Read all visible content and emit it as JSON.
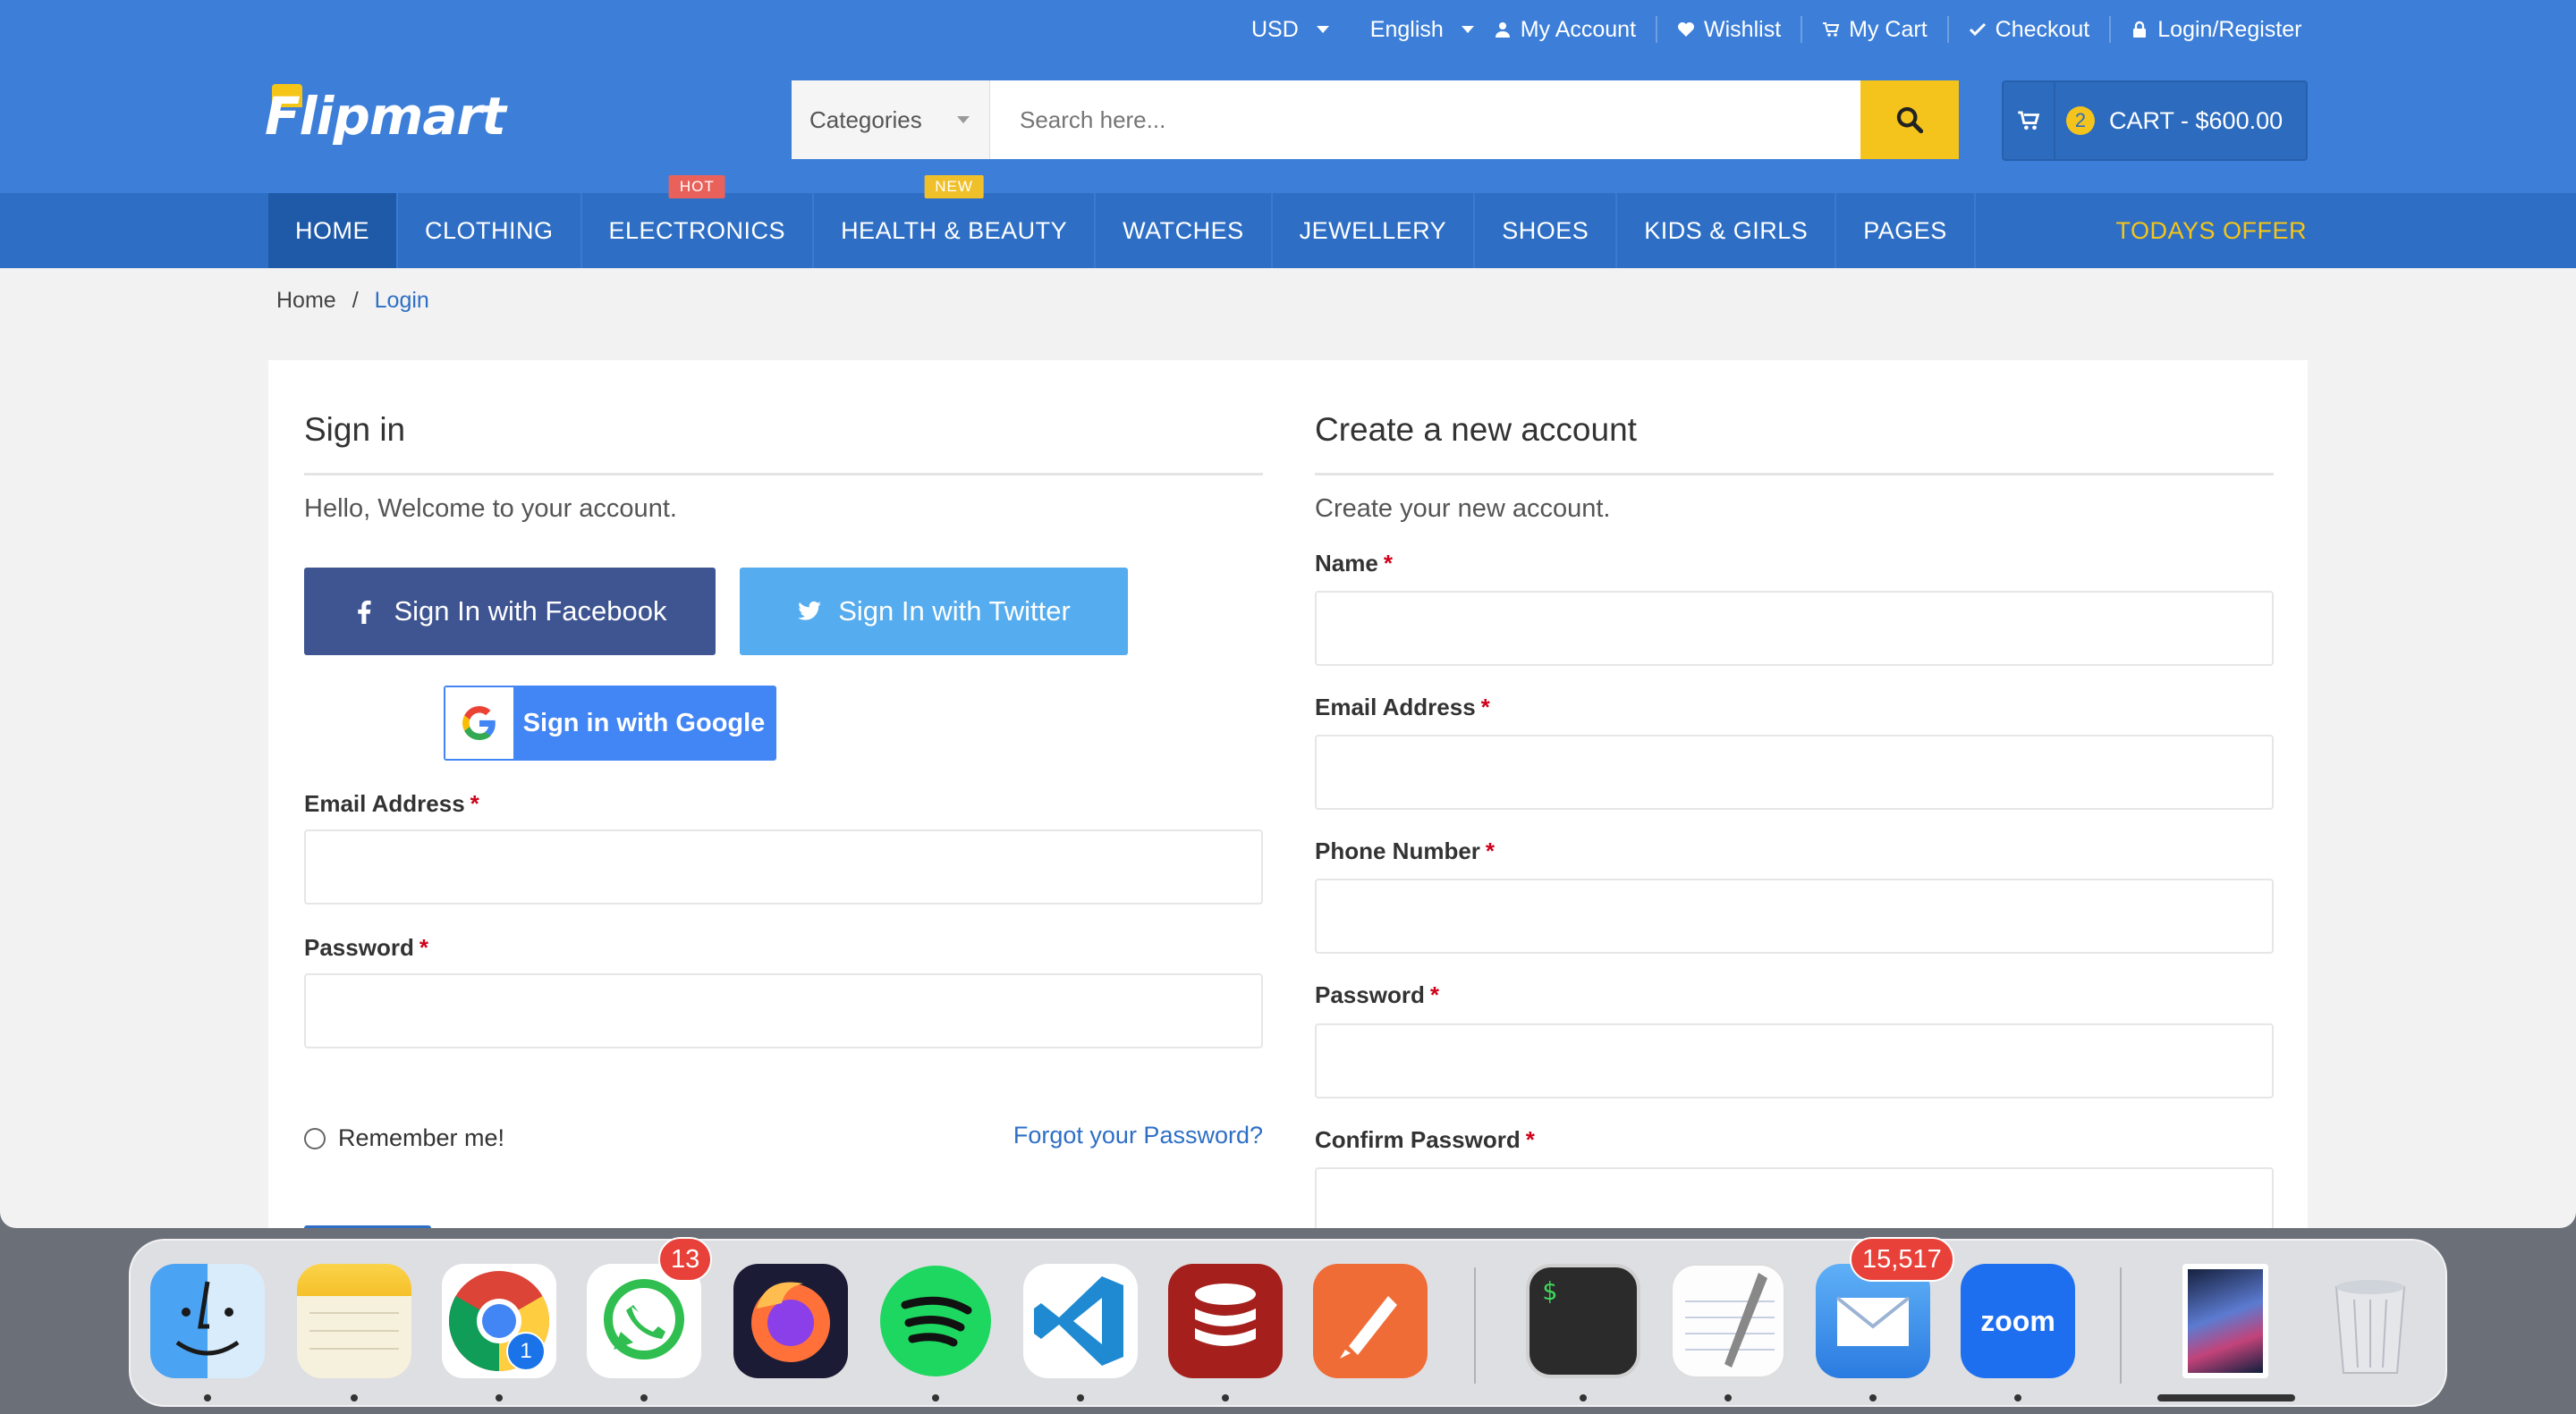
{
  "topbar": {
    "currency": "USD",
    "language": "English",
    "links": [
      "My Account",
      "Wishlist",
      "My Cart",
      "Checkout",
      "Login/Register"
    ]
  },
  "logo": "Flipmart",
  "search": {
    "category": "Categories",
    "placeholder": "Search here..."
  },
  "cart": {
    "count": "2",
    "label": "CART - $600.00"
  },
  "nav": {
    "items": [
      "HOME",
      "CLOTHING",
      "ELECTRONICS",
      "HEALTH & BEAUTY",
      "WATCHES",
      "JEWELLERY",
      "SHOES",
      "KIDS & GIRLS",
      "PAGES"
    ],
    "badges": {
      "hot": "HOT",
      "new": "NEW"
    },
    "offer": "TODAYS OFFER"
  },
  "breadcrumb": {
    "home": "Home",
    "separator": "/",
    "current": "Login"
  },
  "signin": {
    "title": "Sign in",
    "lead": "Hello, Welcome to your account.",
    "facebook": "Sign In with Facebook",
    "twitter": "Sign In with Twitter",
    "google": "Sign in with Google",
    "email_label": "Email Address",
    "password_label": "Password",
    "required": "*",
    "remember": "Remember me!",
    "forgot": "Forgot your Password?"
  },
  "register": {
    "title": "Create a new account",
    "lead": "Create your new account.",
    "fields": [
      "Name",
      "Email Address",
      "Phone Number",
      "Password",
      "Confirm Password"
    ]
  },
  "dock": {
    "apps": [
      "finder-icon",
      "notes-icon",
      "chrome-icon",
      "whatsapp-icon",
      "firefox-icon",
      "spotify-icon",
      "vscode-icon",
      "database-icon",
      "postman-icon",
      "terminal-icon",
      "textedit-icon",
      "mail-icon",
      "zoom-icon",
      "preview-icon",
      "trash-icon"
    ],
    "chrome_badge": "1",
    "whatsapp_badge": "13",
    "mail_badge": "15,517",
    "zoom_label": "zoom",
    "terminal_prompt": "$"
  },
  "colors": {
    "header": "#3d7fd8",
    "nav": "#2e6fc5",
    "accent": "#f4c41c",
    "facebook": "#3f5592",
    "twitter": "#55acee",
    "google": "#4285f4",
    "required": "#d0021b"
  }
}
